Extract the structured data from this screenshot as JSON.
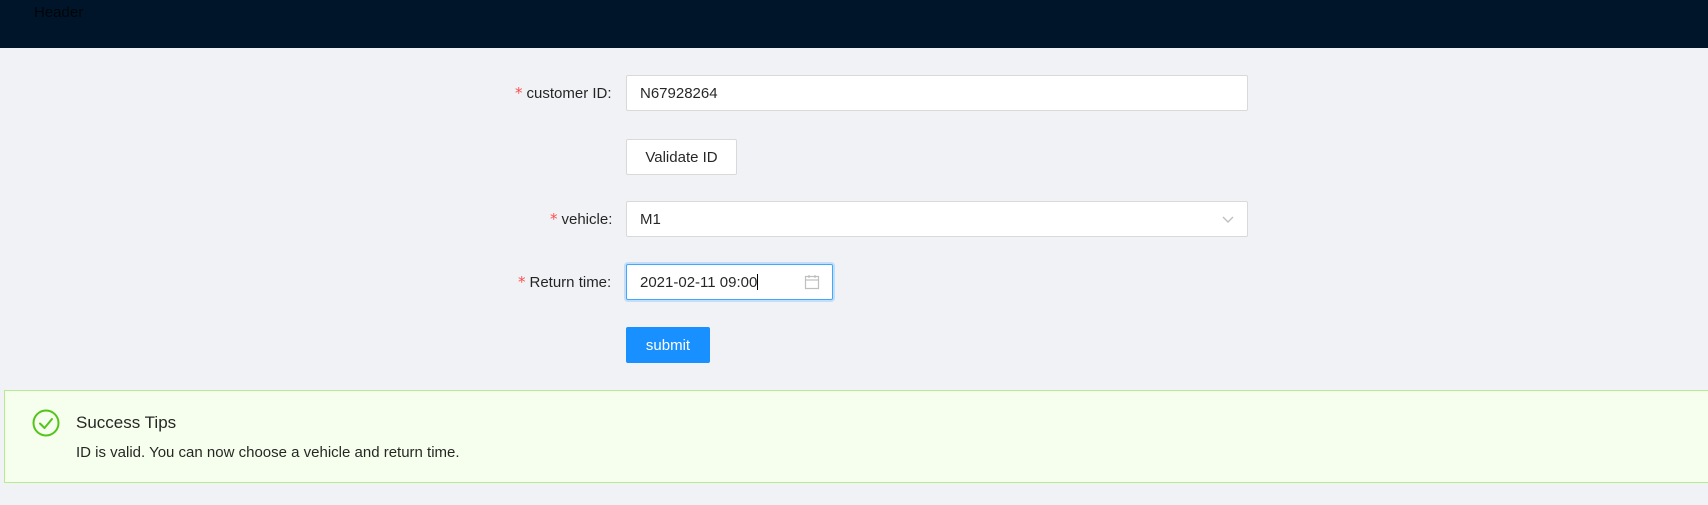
{
  "header": {
    "title": "Header"
  },
  "form": {
    "customer_id": {
      "label": "customer ID",
      "value": "N67928264",
      "required": true
    },
    "validate_button": "Validate ID",
    "vehicle": {
      "label": "vehicle",
      "value": "M1",
      "required": true
    },
    "return_time": {
      "label": "Return time",
      "value": "2021-02-11 09:00",
      "required": true
    },
    "submit_button": "submit",
    "required_mark": "*",
    "colon": ":"
  },
  "alert": {
    "type": "success",
    "title": "Success Tips",
    "description": "ID is valid. You can now choose a vehicle and return time."
  },
  "colors": {
    "header_bg": "#001529",
    "primary": "#1890ff",
    "success": "#52c41a",
    "required": "#ff4d4f"
  }
}
